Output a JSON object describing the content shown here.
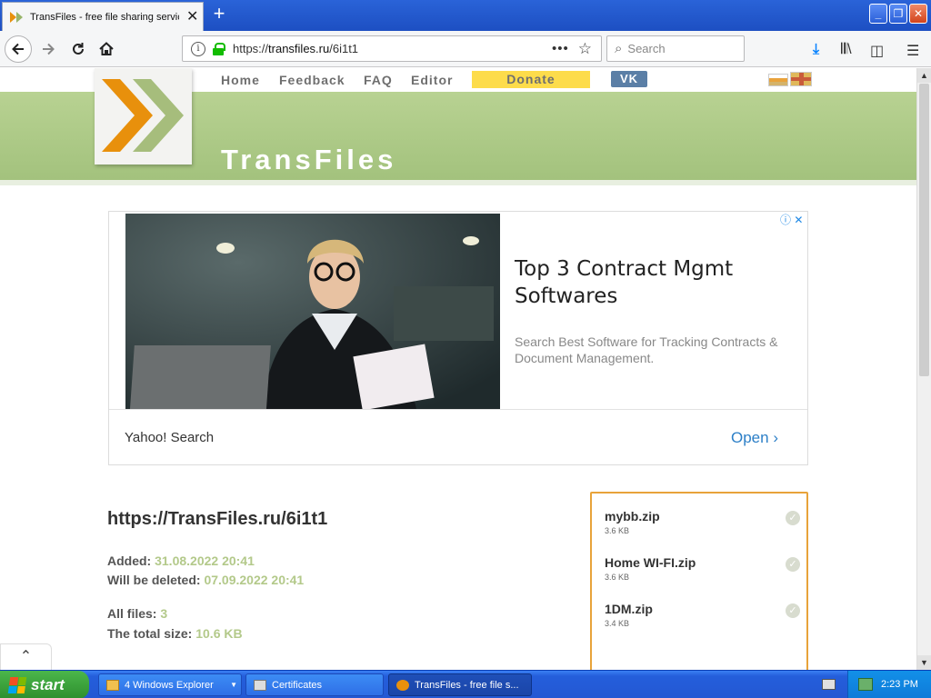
{
  "browser": {
    "tab_title": "TransFiles - free file sharing service",
    "tab_close": "✕",
    "new_tab": "+",
    "url_scheme": "https://",
    "url_host": "transfiles.ru",
    "url_path": "/6i1t1",
    "search_placeholder": "Search"
  },
  "site": {
    "nav": {
      "home": "Home",
      "feedback": "Feedback",
      "faq": "FAQ",
      "editor": "Editor",
      "donate": "Donate",
      "vk": "VK"
    },
    "title": "TransFiles"
  },
  "ad": {
    "headline": "Top 3 Contract Mgmt Softwares",
    "description": "Search Best Software for Tracking Contracts & Document Management.",
    "advertiser": "Yahoo! Search",
    "cta": "Open"
  },
  "file_info": {
    "link": "https://TransFiles.ru/6i1t1",
    "added_label": "Added: ",
    "added_value": "31.08.2022 20:41",
    "deleted_label": "Will be deleted: ",
    "deleted_value": "07.09.2022 20:41",
    "all_files_label": "All files: ",
    "all_files_value": "3",
    "total_size_label": "The total size: ",
    "total_size_value": "10.6 KB"
  },
  "files": [
    {
      "name": "mybb.zip",
      "size": "3.6 KB"
    },
    {
      "name": "Home WI-FI.zip",
      "size": "3.6 KB"
    },
    {
      "name": "1DM.zip",
      "size": "3.4 KB"
    }
  ],
  "taskbar": {
    "start": "start",
    "tasks": {
      "explorer": "4 Windows Explorer",
      "certificates": "Certificates",
      "transfiles": "TransFiles - free file s..."
    },
    "clock": "2:23 PM"
  },
  "colors": {
    "accent_green": "#a3c27d",
    "accent_orange": "#e8900c",
    "donate_yellow": "#fddc4b",
    "vk_blue": "#5b7fa6"
  }
}
